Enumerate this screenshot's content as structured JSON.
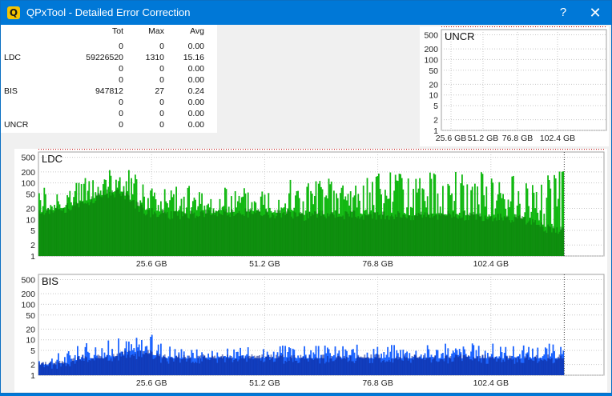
{
  "window": {
    "title": "QPxTool - Detailed Error Correction",
    "app_icon": "Q",
    "help_glyph": "?",
    "close_glyph": "✕"
  },
  "stats": {
    "headers": [
      "Tot",
      "Max",
      "Avg"
    ],
    "rows": [
      {
        "label": "",
        "tot": "0",
        "max": "0",
        "avg": "0.00"
      },
      {
        "label": "LDC",
        "tot": "59226520",
        "max": "1310",
        "avg": "15.16"
      },
      {
        "label": "",
        "tot": "0",
        "max": "0",
        "avg": "0.00"
      },
      {
        "label": "",
        "tot": "0",
        "max": "0",
        "avg": "0.00"
      },
      {
        "label": "BIS",
        "tot": "947812",
        "max": "27",
        "avg": "0.24"
      },
      {
        "label": "",
        "tot": "0",
        "max": "0",
        "avg": "0.00"
      },
      {
        "label": "",
        "tot": "0",
        "max": "0",
        "avg": "0.00"
      },
      {
        "label": "UNCR",
        "tot": "0",
        "max": "0",
        "avg": "0.00"
      }
    ]
  },
  "chart_data": [
    {
      "id": "uncr",
      "type": "area",
      "title": "UNCR",
      "y_scale": "log",
      "yticks": [
        "500",
        "200",
        "100",
        "50",
        "20",
        "10",
        "5",
        "2",
        "1"
      ],
      "xticks": [
        "25.6 GB",
        "51.2 GB",
        "76.8 GB",
        "102.4 GB"
      ],
      "series": [
        {
          "values": []
        }
      ],
      "colors": {
        "fill": "#1c6eff",
        "grid": "#c8c8c8",
        "limit": "#c00000"
      }
    },
    {
      "id": "ldc",
      "type": "area",
      "title": "LDC",
      "y_scale": "log",
      "ylim": [
        1,
        700
      ],
      "xlim_gb": [
        0,
        128
      ],
      "data_end_gb": 119,
      "yticks": [
        "500",
        "200",
        "100",
        "50",
        "20",
        "10",
        "5",
        "2",
        "1"
      ],
      "xticks": [
        "25.6 GB",
        "51.2 GB",
        "76.8 GB",
        "102.4 GB"
      ],
      "xtick_values": [
        25.6,
        51.2,
        76.8,
        102.4
      ],
      "series": [
        {
          "role": "peak",
          "x": [
            0,
            5,
            10,
            15,
            18,
            20,
            22,
            25,
            28,
            30,
            35,
            40,
            45,
            50,
            55,
            60,
            65,
            70,
            75,
            80,
            85,
            90,
            95,
            100,
            105,
            110,
            115,
            119
          ],
          "values": [
            100,
            120,
            150,
            200,
            300,
            260,
            200,
            120,
            110,
            100,
            80,
            70,
            90,
            110,
            140,
            160,
            150,
            180,
            170,
            200,
            150,
            220,
            230,
            200,
            170,
            150,
            300,
            250
          ]
        },
        {
          "role": "typical",
          "x": [
            0,
            5,
            10,
            15,
            18,
            20,
            22,
            25,
            28,
            30,
            35,
            40,
            45,
            50,
            55,
            60,
            65,
            70,
            75,
            80,
            85,
            90,
            95,
            100,
            105,
            110,
            115,
            119
          ],
          "values": [
            15,
            20,
            30,
            50,
            60,
            40,
            25,
            16,
            15,
            14,
            14,
            15,
            16,
            16,
            15,
            13,
            14,
            14,
            14,
            13,
            13,
            14,
            13,
            12,
            12,
            10,
            6,
            5
          ]
        }
      ],
      "colors": {
        "fill": "#12b812",
        "dark": "#0b6f0b",
        "grid": "#c8c8c8",
        "limit": "#c00000"
      }
    },
    {
      "id": "bis",
      "type": "area",
      "title": "BIS",
      "y_scale": "log",
      "ylim": [
        1,
        700
      ],
      "xlim_gb": [
        0,
        128
      ],
      "data_end_gb": 119,
      "yticks": [
        "500",
        "200",
        "100",
        "50",
        "20",
        "10",
        "5",
        "2",
        "1"
      ],
      "xticks": [
        "25.6 GB",
        "51.2 GB",
        "76.8 GB",
        "102.4 GB"
      ],
      "xtick_values": [
        25.6,
        51.2,
        76.8,
        102.4
      ],
      "series": [
        {
          "role": "peak",
          "x": [
            0,
            5,
            10,
            15,
            20,
            25,
            28,
            30,
            35,
            40,
            45,
            50,
            55,
            60,
            65,
            70,
            75,
            80,
            85,
            90,
            95,
            100,
            105,
            110,
            115,
            119
          ],
          "values": [
            4,
            5,
            8,
            10,
            12,
            15,
            10,
            8,
            6,
            6,
            6,
            7,
            7,
            7,
            7,
            8,
            8,
            8,
            8,
            8,
            8,
            8,
            8,
            7,
            9,
            6
          ]
        },
        {
          "role": "typical",
          "x": [
            0,
            5,
            10,
            15,
            20,
            25,
            28,
            30,
            35,
            40,
            45,
            50,
            55,
            60,
            65,
            70,
            75,
            80,
            85,
            90,
            95,
            100,
            105,
            110,
            115,
            119
          ],
          "values": [
            2,
            2,
            3,
            3,
            4,
            4,
            3,
            3,
            3,
            3,
            3,
            3,
            3,
            3,
            3,
            3,
            3,
            3,
            3,
            3,
            3,
            3,
            3,
            3,
            3,
            3
          ]
        }
      ],
      "colors": {
        "fill": "#1c64ff",
        "dark": "#0a1f8a",
        "grid": "#c8c8c8",
        "limit": "#c00000"
      }
    }
  ]
}
